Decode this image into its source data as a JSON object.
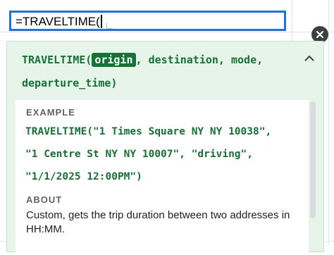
{
  "formula_bar": {
    "text": "=TRAVELTIME("
  },
  "help_card": {
    "function_name": "TRAVELTIME(",
    "active_param": "origin",
    "rest_line1": ", destination, mode,",
    "rest_line2": "departure_time)",
    "example_label": "EXAMPLE",
    "example_code": "TRAVELTIME(\"1 Times Square NY NY 10038\",\n\"1 Centre St NY NY 10007\", \"driving\",\n\"1/1/2025 12:00PM\")",
    "about_label": "ABOUT",
    "about_text": "Custom, gets the trip duration between two addresses in HH:MM."
  },
  "icons": {
    "close": "close-icon",
    "collapse": "chevron-up-icon"
  },
  "colors": {
    "accent_blue": "#1a73e8",
    "card_bg": "#e6f4ea",
    "signature_green": "#137333",
    "close_bg": "#3c4043"
  }
}
